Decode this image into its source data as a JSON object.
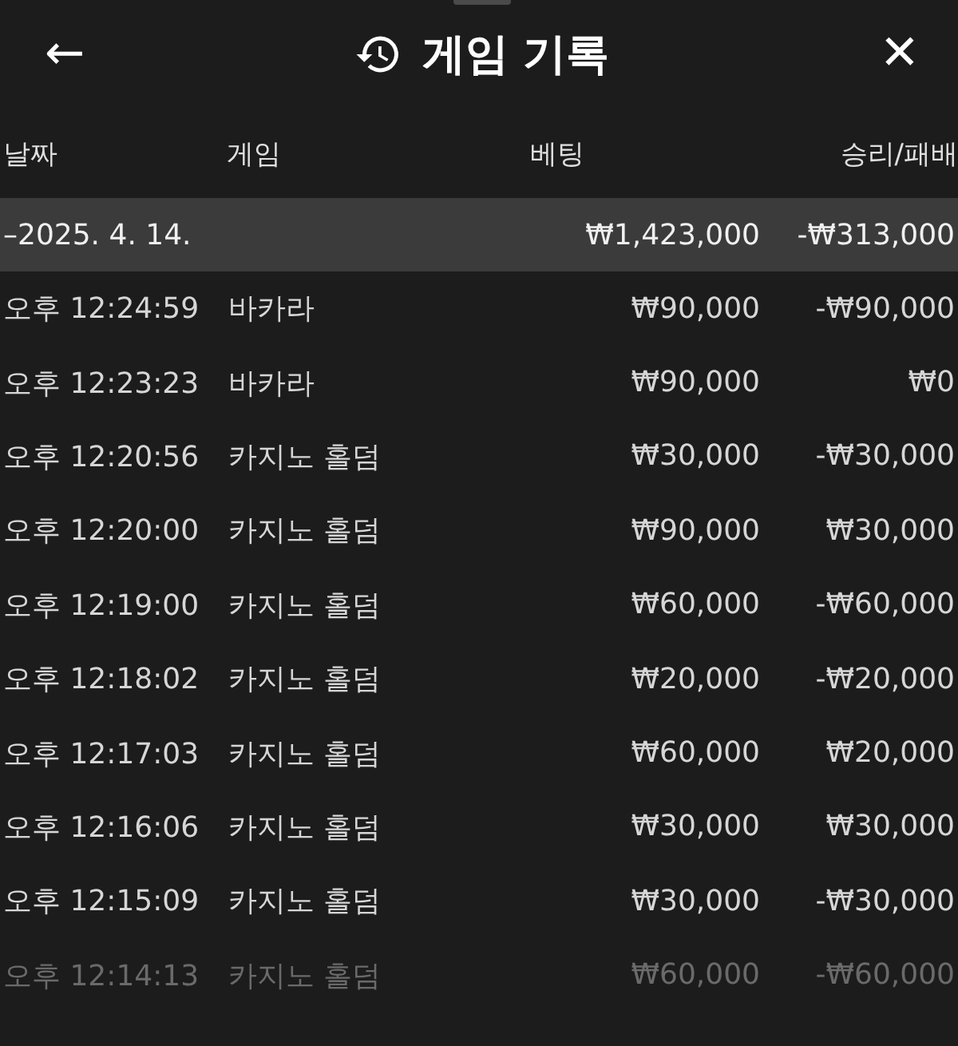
{
  "header": {
    "title": "게임 기록",
    "back": "←",
    "close": "✕"
  },
  "columns": [
    "날짜",
    "게임",
    "베팅",
    "승리/패배"
  ],
  "groups": [
    {
      "date": "–2025. 4. 14.",
      "bet": "₩1,423,000",
      "result": "-₩313,000",
      "expanded": true,
      "rows": [
        {
          "time": "오후 12:24:59",
          "game": "바카라",
          "bet": "₩90,000",
          "result": "-₩90,000",
          "faded": false
        },
        {
          "time": "오후 12:23:23",
          "game": "바카라",
          "bet": "₩90,000",
          "result": "₩0",
          "faded": false
        },
        {
          "time": "오후 12:20:56",
          "game": "카지노 홀덤",
          "bet": "₩30,000",
          "result": "-₩30,000",
          "faded": false
        },
        {
          "time": "오후 12:20:00",
          "game": "카지노 홀덤",
          "bet": "₩90,000",
          "result": "₩30,000",
          "faded": false
        },
        {
          "time": "오후 12:19:00",
          "game": "카지노 홀덤",
          "bet": "₩60,000",
          "result": "-₩60,000",
          "faded": false
        },
        {
          "time": "오후 12:18:02",
          "game": "카지노 홀덤",
          "bet": "₩20,000",
          "result": "-₩20,000",
          "faded": false
        },
        {
          "time": "오후 12:17:03",
          "game": "카지노 홀덤",
          "bet": "₩60,000",
          "result": "₩20,000",
          "faded": false
        },
        {
          "time": "오후 12:16:06",
          "game": "카지노 홀덤",
          "bet": "₩30,000",
          "result": "₩30,000",
          "faded": false
        },
        {
          "time": "오후 12:15:09",
          "game": "카지노 홀덤",
          "bet": "₩30,000",
          "result": "-₩30,000",
          "faded": false
        },
        {
          "time": "오후 12:14:13",
          "game": "카지노 홀덤",
          "bet": "₩60,000",
          "result": "-₩60,000",
          "faded": true
        }
      ]
    }
  ]
}
